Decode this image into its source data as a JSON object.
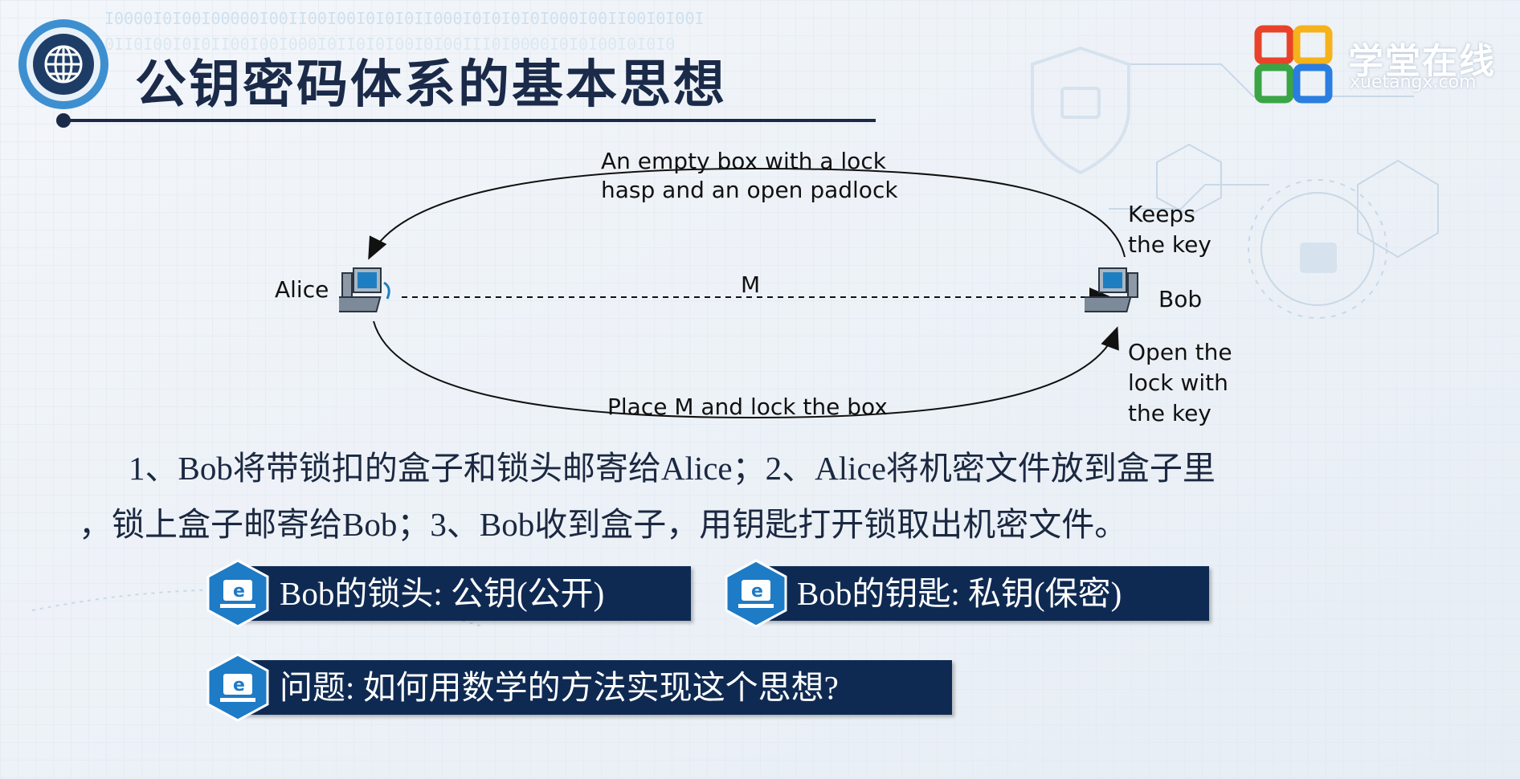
{
  "slide": {
    "title": "公钥密码体系的基本思想",
    "globe_icon": "globe-icon"
  },
  "brand": {
    "name": "学堂在线",
    "url": "xuetangx.com",
    "logo_colors": [
      "#e8432a",
      "#f6b21a",
      "#3aa545",
      "#2a7de1"
    ]
  },
  "diagram": {
    "top_label_line1": "An empty box with a lock",
    "top_label_line2": "hasp and an open padlock",
    "alice": "Alice",
    "bob": "Bob",
    "message": "M",
    "keeps_line1": "Keeps",
    "keeps_line2": "the key",
    "bottom_label": "Place M and lock the box",
    "open_line1": "Open the",
    "open_line2": "lock with",
    "open_line3": "the key",
    "computer_icon": "computer-icon"
  },
  "description": {
    "line1": "1、Bob将带锁扣的盒子和锁头邮寄给Alice；2、Alice将机密文件放到盒子里",
    "line2": "，锁上盒子邮寄给Bob；3、Bob收到盒子，用钥匙打开锁取出机密文件。"
  },
  "points": [
    {
      "text": "Bob的锁头: 公钥(公开)",
      "icon": "e-learning-icon"
    },
    {
      "text": "Bob的钥匙: 私钥(保密)",
      "icon": "e-learning-icon"
    },
    {
      "text": "问题: 如何用数学的方法实现这个思想?",
      "icon": "e-learning-icon"
    }
  ],
  "colors": {
    "navy": "#0f2a52",
    "hex_blue": "#1e7bc6",
    "title": "#1a2a48"
  }
}
